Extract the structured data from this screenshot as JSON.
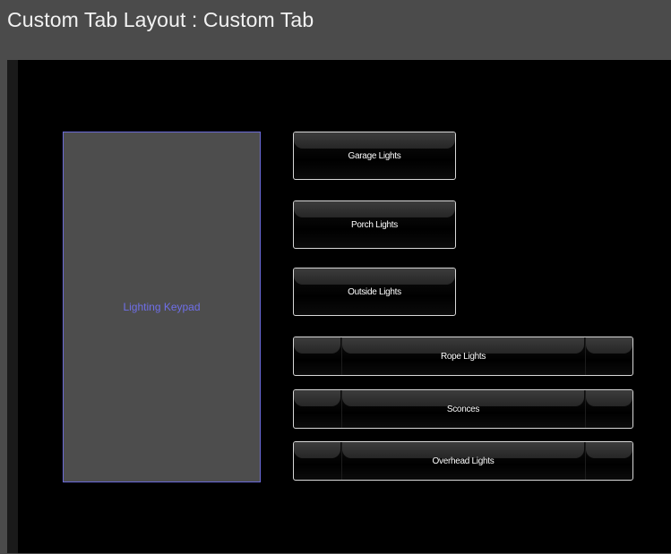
{
  "window": {
    "title": "Custom Tab Layout : Custom Tab"
  },
  "keypad": {
    "label": "Lighting Keypad"
  },
  "buttons": [
    {
      "label": "Garage Lights"
    },
    {
      "label": "Porch Lights"
    },
    {
      "label": "Outside Lights"
    },
    {
      "label": "Rope Lights"
    },
    {
      "label": "Sconces"
    },
    {
      "label": "Overhead Lights"
    }
  ],
  "colors": {
    "background": "#4b4b4b",
    "canvas": "#000000",
    "keypad_fill": "#4d4d4d",
    "keypad_border": "#6a6ad8",
    "keypad_text": "#6f6fe8",
    "button_border": "#d8d8d8",
    "button_text": "#ffffff"
  }
}
